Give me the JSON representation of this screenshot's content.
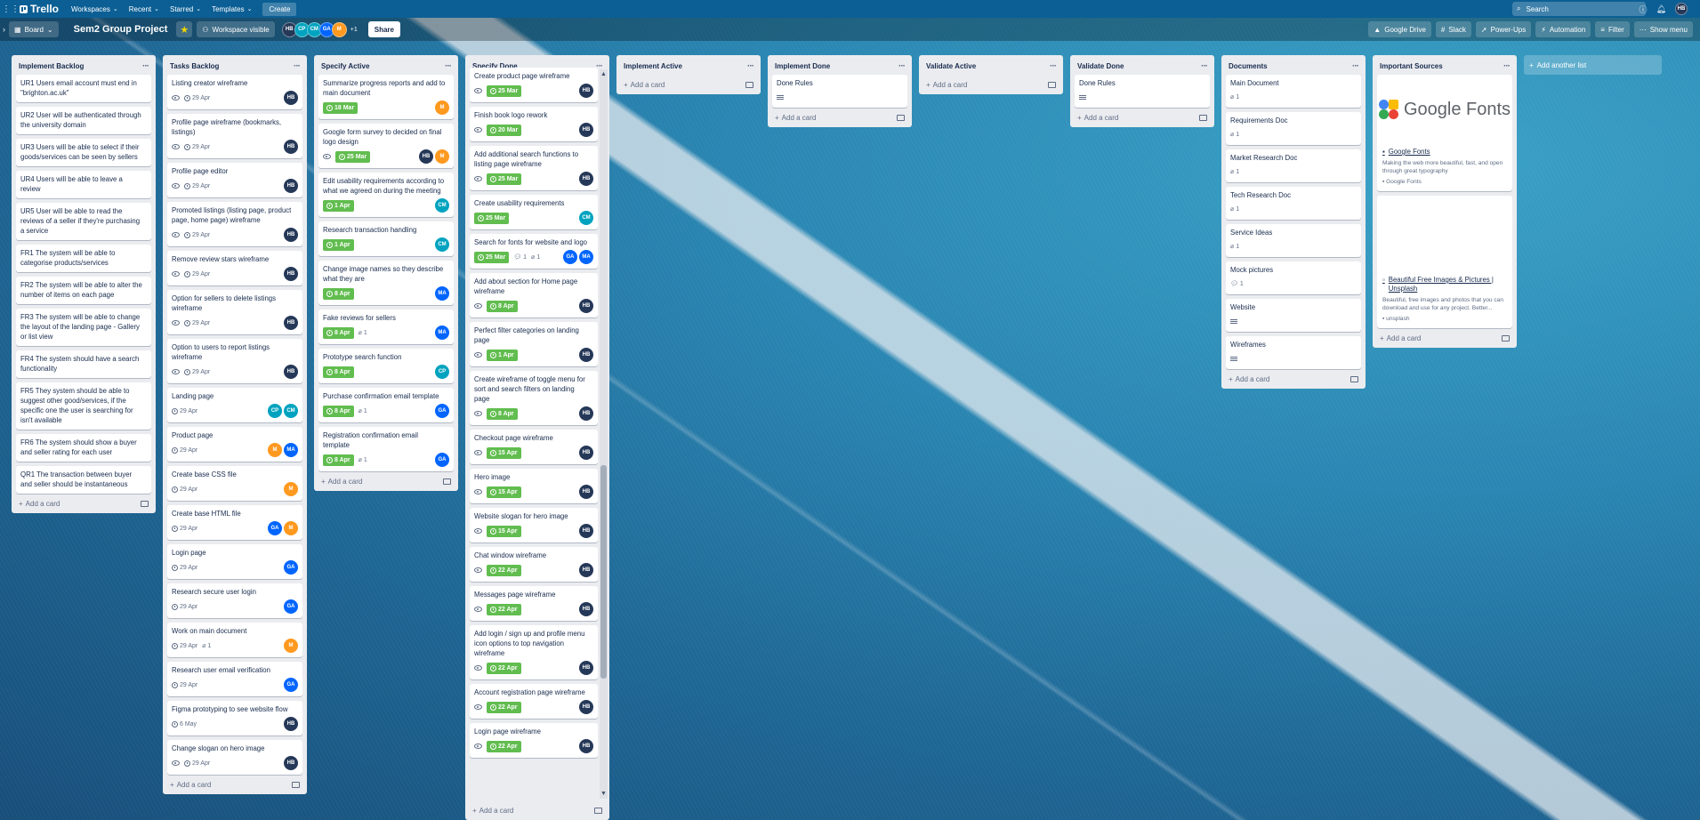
{
  "topbar": {
    "app_name": "Trello",
    "menus": [
      "Workspaces",
      "Recent",
      "Starred",
      "Templates"
    ],
    "create_label": "Create",
    "search_placeholder": "Search",
    "user_initials": "HB"
  },
  "boardbar": {
    "view_label": "Board",
    "title": "Sem2 Group Project",
    "visibility": "Workspace visible",
    "members": [
      {
        "initials": "HB",
        "color": "#253858"
      },
      {
        "initials": "CP",
        "color": "#00a3bf"
      },
      {
        "initials": "CM",
        "color": "#00a3bf"
      },
      {
        "initials": "GA",
        "color": "#0065ff"
      },
      {
        "initials": "M",
        "color": "#ff991f"
      }
    ],
    "member_more": "+1",
    "share_label": "Share",
    "right_buttons": [
      "Google Drive",
      "Slack",
      "Power-Ups",
      "Automation",
      "Filter",
      "Show menu"
    ]
  },
  "colors": {
    "green_date": "#61bd4f",
    "HB": "#253858",
    "GA": "#0065ff",
    "MA": "#0065ff",
    "CM": "#00a3bf",
    "CP": "#00a3bf",
    "M": "#ff991f"
  },
  "lists": [
    {
      "name": "Implement Backlog",
      "add_label": "Add a card",
      "cards": [
        {
          "title": "UR1 Users email account must end in \"brighton.ac.uk\""
        },
        {
          "title": "UR2 User will be authenticated through the university domain"
        },
        {
          "title": "UR3 Users will be able to select if their goods/services can be seen by sellers"
        },
        {
          "title": "UR4 Users will be able to leave a review"
        },
        {
          "title": "UR5 User will be able to read the reviews of a seller if they're purchasing a service"
        },
        {
          "title": "FR1 The system will be able to categorise products/services"
        },
        {
          "title": "FR2 The system will be able to alter the number of items on each page"
        },
        {
          "title": "FR3 The system will be able to change the layout of the landing page - Gallery or list view"
        },
        {
          "title": "FR4 The system should have a search functionality"
        },
        {
          "title": "FR5 They system should be able to suggest other good/services, if the specific one the user is searching for isn't available"
        },
        {
          "title": "FR6 The system should show a buyer and seller rating for each user"
        },
        {
          "title": "QR1 The transaction between buyer and seller should be instantaneous"
        }
      ]
    },
    {
      "name": "Tasks Backlog",
      "add_label": "Add a card",
      "cards": [
        {
          "title": "Listing creator wireframe",
          "watch": true,
          "date": "29 Apr",
          "members": [
            "HB"
          ]
        },
        {
          "title": "Profile page wireframe (bookmarks, listings)",
          "watch": true,
          "date": "29 Apr",
          "members": [
            "HB"
          ]
        },
        {
          "title": "Profile page editor",
          "watch": true,
          "date": "29 Apr",
          "members": [
            "HB"
          ]
        },
        {
          "title": "Promoted listings (listing page, product page, home page) wireframe",
          "watch": true,
          "date": "29 Apr",
          "members": [
            "HB"
          ]
        },
        {
          "title": "Remove review stars wireframe",
          "watch": true,
          "date": "29 Apr",
          "members": [
            "HB"
          ]
        },
        {
          "title": "Option for sellers to delete listings wireframe",
          "watch": true,
          "date": "29 Apr",
          "members": [
            "HB"
          ]
        },
        {
          "title": "Option to users to report listings wireframe",
          "watch": true,
          "date": "29 Apr",
          "members": [
            "HB"
          ]
        },
        {
          "title": "Landing page",
          "date": "29 Apr",
          "members": [
            "CP",
            "CM"
          ]
        },
        {
          "title": "Product page",
          "date": "29 Apr",
          "members": [
            "M",
            "MA"
          ]
        },
        {
          "title": "Create base CSS file",
          "date": "29 Apr",
          "members": [
            "M"
          ]
        },
        {
          "title": "Create base HTML file",
          "date": "29 Apr",
          "members": [
            "GA",
            "M"
          ]
        },
        {
          "title": "Login page",
          "date": "29 Apr",
          "members": [
            "GA"
          ]
        },
        {
          "title": "Research secure user login",
          "date": "29 Apr",
          "members": [
            "GA"
          ]
        },
        {
          "title": "Work on main document",
          "date": "29 Apr",
          "attach": "1",
          "members": [
            "M"
          ]
        },
        {
          "title": "Research user email verification",
          "date": "29 Apr",
          "members": [
            "GA"
          ]
        },
        {
          "title": "Figma prototyping to see website flow",
          "date": "6 May",
          "members": [
            "HB"
          ]
        },
        {
          "title": "Change slogan on hero image",
          "watch": true,
          "date": "29 Apr",
          "members": [
            "HB"
          ]
        }
      ]
    },
    {
      "name": "Specify Active",
      "add_label": "Add a card",
      "cards": [
        {
          "title": "Summarize progress reports and add to main document",
          "date": "18 Mar",
          "green": true,
          "members": [
            "M"
          ]
        },
        {
          "title": "Google form survey to decided on final logo design",
          "watch": true,
          "date": "25 Mar",
          "green": true,
          "members": [
            "HB",
            "M"
          ]
        },
        {
          "title": "Edit usability requirements according to what we agreed on during the meeting",
          "date": "1 Apr",
          "green": true,
          "members": [
            "CM"
          ]
        },
        {
          "title": "Research transaction handling",
          "date": "1 Apr",
          "green": true,
          "members": [
            "CM"
          ]
        },
        {
          "title": "Change image names so they describe what they are",
          "date": "8 Apr",
          "green": true,
          "members": [
            "MA"
          ]
        },
        {
          "title": "Fake reviews for sellers",
          "date": "8 Apr",
          "green": true,
          "attach": "1",
          "members": [
            "MA"
          ]
        },
        {
          "title": "Prototype search function",
          "date": "8 Apr",
          "green": true,
          "members": [
            "CP"
          ]
        },
        {
          "title": "Purchase confirmation email template",
          "date": "8 Apr",
          "green": true,
          "attach": "1",
          "members": [
            "GA"
          ]
        },
        {
          "title": "Registration confirmation email template",
          "date": "8 Apr",
          "green": true,
          "attach": "1",
          "members": [
            "GA"
          ]
        }
      ]
    },
    {
      "name": "Specify Done",
      "add_label": "Add a card",
      "cards": [
        {
          "title": "Create product page wireframe",
          "watch": true,
          "date": "25 Mar",
          "green": true,
          "members": [
            "HB"
          ]
        },
        {
          "title": "Finish book logo rework",
          "watch": true,
          "date": "20 Mar",
          "green": true,
          "members": [
            "HB"
          ]
        },
        {
          "title": "Add additional search functions to listing page wireframe",
          "watch": true,
          "date": "25 Mar",
          "green": true,
          "members": [
            "HB"
          ]
        },
        {
          "title": "Create usability requirements",
          "date": "25 Mar",
          "green": true,
          "members": [
            "CM"
          ]
        },
        {
          "title": "Search for fonts for website and logo",
          "date": "25 Mar",
          "green": true,
          "comments": "1",
          "attach": "1",
          "members": [
            "GA",
            "MA"
          ]
        },
        {
          "title": "Add about section for Home page wireframe",
          "watch": true,
          "date": "8 Apr",
          "green": true,
          "members": [
            "HB"
          ]
        },
        {
          "title": "Perfect filter categories on landing page",
          "watch": true,
          "date": "1 Apr",
          "green": true,
          "members": [
            "HB"
          ]
        },
        {
          "title": "Create wireframe of toggle menu for sort and search filters on landing page",
          "watch": true,
          "date": "8 Apr",
          "green": true,
          "members": [
            "HB"
          ]
        },
        {
          "title": "Checkout page wireframe",
          "watch": true,
          "date": "15 Apr",
          "green": true,
          "members": [
            "HB"
          ]
        },
        {
          "title": "Hero image",
          "watch": true,
          "date": "15 Apr",
          "green": true,
          "members": [
            "HB"
          ]
        },
        {
          "title": "Website slogan for hero image",
          "watch": true,
          "date": "15 Apr",
          "green": true,
          "members": [
            "HB"
          ]
        },
        {
          "title": "Chat window wireframe",
          "watch": true,
          "date": "22 Apr",
          "green": true,
          "members": [
            "HB"
          ]
        },
        {
          "title": "Messages page wireframe",
          "watch": true,
          "date": "22 Apr",
          "green": true,
          "members": [
            "HB"
          ]
        },
        {
          "title": "Add login / sign up and profile menu icon options to top navigation wireframe",
          "watch": true,
          "date": "22 Apr",
          "green": true,
          "members": [
            "HB"
          ]
        },
        {
          "title": "Account registration page wireframe",
          "watch": true,
          "date": "22 Apr",
          "green": true,
          "members": [
            "HB"
          ]
        },
        {
          "title": "Login page wireframe",
          "watch": true,
          "date": "22 Apr",
          "green": true,
          "members": [
            "HB"
          ]
        }
      ]
    },
    {
      "name": "Implement Active",
      "add_label": "Add a card",
      "cards": []
    },
    {
      "name": "Implement Done",
      "add_label": "Add a card",
      "cards": [
        {
          "title": "Done Rules",
          "desc": true
        }
      ]
    },
    {
      "name": "Validate Active",
      "add_label": "Add a card",
      "cards": []
    },
    {
      "name": "Validate Done",
      "add_label": "Add a card",
      "cards": [
        {
          "title": "Done Rules",
          "desc": true
        }
      ]
    },
    {
      "name": "Documents",
      "add_label": "Add a card",
      "cards": [
        {
          "title": "Main Document",
          "attach": "1"
        },
        {
          "title": "Requirements Doc",
          "attach": "1"
        },
        {
          "title": "Market Research Doc",
          "attach": "1"
        },
        {
          "title": "Tech Research Doc",
          "attach": "1"
        },
        {
          "title": "Service Ideas",
          "attach": "1"
        },
        {
          "title": "Mock pictures",
          "comments": "1"
        },
        {
          "title": "Website",
          "desc": true
        },
        {
          "title": "Wireframes",
          "desc": true
        }
      ]
    },
    {
      "name": "Important Sources",
      "add_label": "Add a card",
      "links": [
        {
          "logo_text": "Google Fonts",
          "title": "Google Fonts",
          "desc": "Making the web more beautiful, fast, and open through great typography",
          "source": "Google Fonts"
        },
        {
          "title": "Beautiful Free Images & Pictures | Unsplash",
          "desc": "Beautiful, free images and photos that you can download and use for any project. Better...",
          "source": "unsplash"
        }
      ]
    }
  ],
  "add_list_label": "Add another list"
}
